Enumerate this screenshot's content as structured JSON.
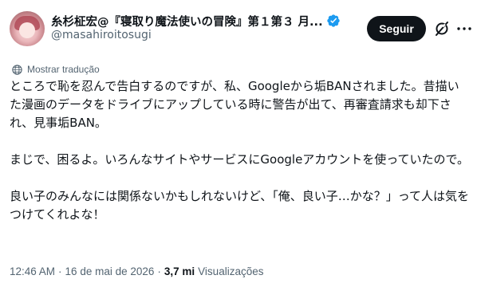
{
  "author": {
    "display_name": "糸杉柾宏@『寝取り魔法使いの冒険』第１第３ 月...",
    "handle": "@masahiroitosugi",
    "verified": true,
    "avatar_icon": "avatar-illustration"
  },
  "actions": {
    "follow_label": "Seguir",
    "grok_icon": "grok-icon",
    "more_icon": "more-icon"
  },
  "translate": {
    "label": "Mostrar tradução",
    "icon": "globe-icon"
  },
  "tweet": {
    "paragraphs": [
      "ところで恥を忍んで告白するのですが、私、Googleから垢BANされました。昔描いた漫画のデータをドライブにアップしている時に警告が出て、再審査請求も却下され、見事垢BAN。",
      "まじで、困るよ。いろんなサイトやサービスにGoogleアカウントを使っていたので。",
      "良い子のみんなには関係ないかもしれないけど、「俺、良い子…かな？」って人は気をつけてくれよな！"
    ]
  },
  "meta": {
    "time": "12:46 AM",
    "separator": "·",
    "date": "16 de mai de 2026",
    "views_count": "3,7 mi",
    "views_label": "Visualizações"
  },
  "colors": {
    "text": "#0f1419",
    "secondary": "#536471",
    "verified": "#1d9bf0",
    "button_bg": "#0f1419",
    "button_text": "#ffffff"
  }
}
